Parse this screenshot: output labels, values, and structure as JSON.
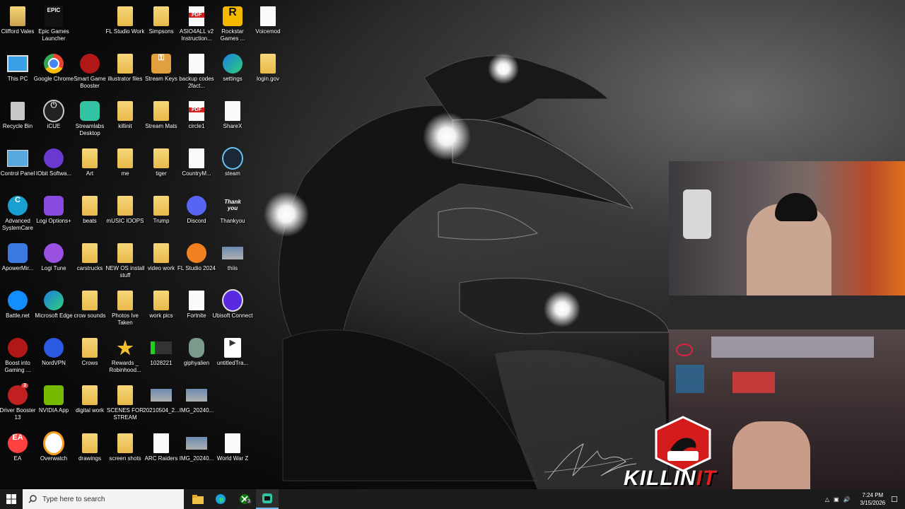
{
  "desktop": {
    "icons": [
      {
        "label": "Clifford Vales",
        "kind": "folder-user"
      },
      {
        "label": "Epic Games Launcher",
        "kind": "epic"
      },
      {
        "label": "FL Studio Work",
        "kind": "folder"
      },
      {
        "label": "Simpsons",
        "kind": "folder"
      },
      {
        "label": "ASIO4ALL v2 Instruction...",
        "kind": "pdf"
      },
      {
        "label": "Rockstar Games ...",
        "kind": "rockstar"
      },
      {
        "label": "Voicemod",
        "kind": "doc"
      },
      {
        "label": "This PC",
        "kind": "pc"
      },
      {
        "label": "Google Chrome",
        "kind": "chrome"
      },
      {
        "label": "Smart Game Booster",
        "kind": "booster"
      },
      {
        "label": "illustrator files",
        "kind": "folder"
      },
      {
        "label": "Stream Keys",
        "kind": "keys"
      },
      {
        "label": "backup codes 2fact...",
        "kind": "doc"
      },
      {
        "label": "settings",
        "kind": "edge"
      },
      {
        "label": "login.gov",
        "kind": "folder"
      },
      {
        "label": "Recycle Bin",
        "kind": "bin"
      },
      {
        "label": "iCUE",
        "kind": "icue"
      },
      {
        "label": "Streamlabs Desktop",
        "kind": "streamlabs"
      },
      {
        "label": "killinit",
        "kind": "folder"
      },
      {
        "label": "Stream Mats",
        "kind": "folder"
      },
      {
        "label": "circle1",
        "kind": "pdf"
      },
      {
        "label": "ShareX",
        "kind": "doc"
      },
      {
        "label": "Control Panel",
        "kind": "cpanel"
      },
      {
        "label": "IObit Softwa...",
        "kind": "iobit"
      },
      {
        "label": "Art",
        "kind": "folder"
      },
      {
        "label": "me",
        "kind": "folder"
      },
      {
        "label": "tiger",
        "kind": "folder"
      },
      {
        "label": "CountryM...",
        "kind": "doc"
      },
      {
        "label": "steam",
        "kind": "steam"
      },
      {
        "label": "Advanced SystemCare",
        "kind": "asc"
      },
      {
        "label": "Logi Options+",
        "kind": "logi"
      },
      {
        "label": "beats",
        "kind": "folder"
      },
      {
        "label": "mUSIC lOOPS",
        "kind": "folder"
      },
      {
        "label": "Trump",
        "kind": "folder"
      },
      {
        "label": "Discord",
        "kind": "discord"
      },
      {
        "label": "Thankyou",
        "kind": "thankyou"
      },
      {
        "label": "ApowerMir...",
        "kind": "apower"
      },
      {
        "label": "Logi Tune",
        "kind": "logitune"
      },
      {
        "label": "carstrucks",
        "kind": "folder"
      },
      {
        "label": "NEW OS install stuff",
        "kind": "folder"
      },
      {
        "label": "video work",
        "kind": "folder"
      },
      {
        "label": "FL Studio 2024",
        "kind": "fl"
      },
      {
        "label": "thiis",
        "kind": "image"
      },
      {
        "label": "Battle.net",
        "kind": "battlenet"
      },
      {
        "label": "Microsoft Edge",
        "kind": "edge"
      },
      {
        "label": "crow sounds",
        "kind": "folder"
      },
      {
        "label": "Photos Ive Taken",
        "kind": "folder"
      },
      {
        "label": "work pics",
        "kind": "folder"
      },
      {
        "label": "Fortnite",
        "kind": "doc"
      },
      {
        "label": "Ubisoft Connect",
        "kind": "ubisoft"
      },
      {
        "label": "Boost into Gaming ...",
        "kind": "booster"
      },
      {
        "label": "NordVPN",
        "kind": "nord"
      },
      {
        "label": "Crows",
        "kind": "folder"
      },
      {
        "label": "Rewards _ Robinhood...",
        "kind": "star"
      },
      {
        "label": "1028221",
        "kind": "green"
      },
      {
        "label": "giphyalien",
        "kind": "alien"
      },
      {
        "label": "untitledTra...",
        "kind": "video"
      },
      {
        "label": "Driver Booster 13",
        "kind": "driver"
      },
      {
        "label": "NVIDIA App",
        "kind": "nvidia"
      },
      {
        "label": "digital work",
        "kind": "folder"
      },
      {
        "label": "SCENES FOR STREAM",
        "kind": "folder"
      },
      {
        "label": "20210504_2...",
        "kind": "image"
      },
      {
        "label": "IMG_20240...",
        "kind": "image"
      },
      {
        "label": "EA",
        "kind": "ea"
      },
      {
        "label": "Overwatch",
        "kind": "overwatch"
      },
      {
        "label": "drawings",
        "kind": "folder"
      },
      {
        "label": "screen shots",
        "kind": "folder"
      },
      {
        "label": "ARC Raiders",
        "kind": "doc"
      },
      {
        "label": "IMG_20240...",
        "kind": "image"
      },
      {
        "label": "World War Z",
        "kind": "doc"
      }
    ]
  },
  "overlay": {
    "brand_left": "KILLIN",
    "brand_right": "IT"
  },
  "taskbar": {
    "search_placeholder": "Type here to search",
    "xbox_badge": "3",
    "time": "7:24 PM",
    "date": "3/15/2026"
  },
  "badges": {
    "driver_booster": "3"
  },
  "colors": {
    "taskbar": "#1c1c1c",
    "accent": "#76b9ed",
    "brand_red": "#e02020"
  }
}
